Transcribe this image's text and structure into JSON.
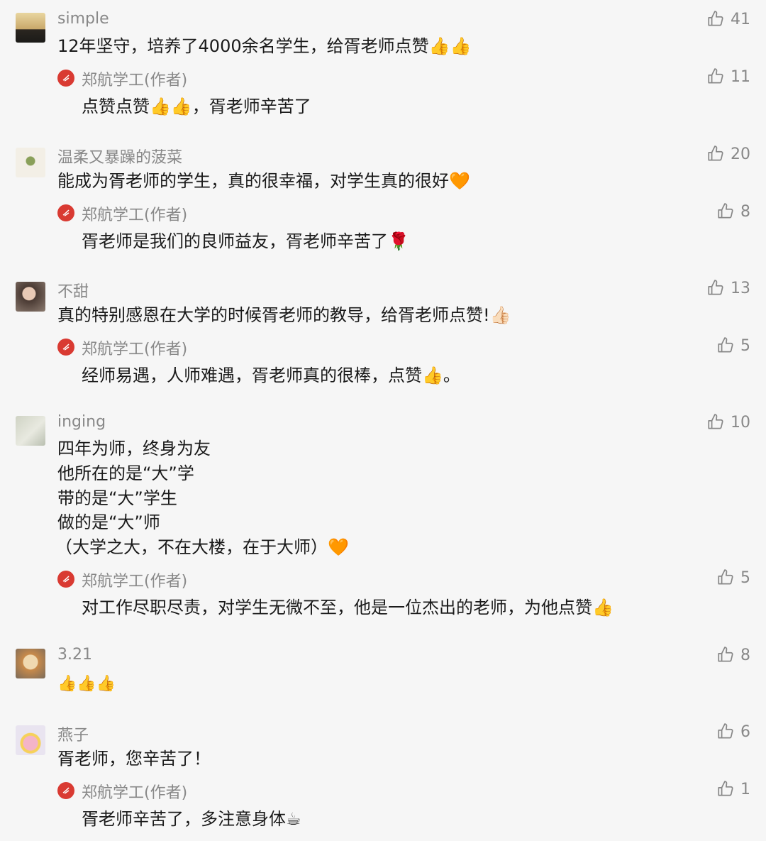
{
  "comments": [
    {
      "nickname": "simple",
      "lines": [
        "12年坚守，培养了4000余名学生，给胥老师点赞👍👍"
      ],
      "likes": "41",
      "reply": {
        "author": "郑航学工(作者)",
        "text": "点赞点赞👍👍，胥老师辛苦了",
        "likes": "11"
      }
    },
    {
      "nickname": "温柔又暴躁的菠菜",
      "lines": [
        "能成为胥老师的学生，真的很幸福，对学生真的很好🧡"
      ],
      "likes": "20",
      "reply": {
        "author": "郑航学工(作者)",
        "text": "胥老师是我们的良师益友，胥老师辛苦了🌹",
        "likes": "8"
      }
    },
    {
      "nickname": "不甜",
      "lines": [
        "真的特别感恩在大学的时候胥老师的教导，给胥老师点赞!👍🏻"
      ],
      "likes": "13",
      "reply": {
        "author": "郑航学工(作者)",
        "text": "经师易遇，人师难遇，胥老师真的很棒，点赞👍。",
        "likes": "5"
      }
    },
    {
      "nickname": "inging",
      "lines": [
        "四年为师，终身为友",
        "他所在的是“大”学",
        "带的是“大”学生",
        "做的是“大”师",
        "（大学之大，不在大楼，在于大师）🧡"
      ],
      "likes": "10",
      "reply": {
        "author": "郑航学工(作者)",
        "text": "对工作尽职尽责，对学生无微不至，他是一位杰出的老师，为他点赞👍",
        "likes": "5"
      }
    },
    {
      "nickname": "3.21",
      "lines": [
        "👍👍👍"
      ],
      "likes": "8"
    },
    {
      "nickname": "燕子",
      "lines": [
        "胥老师，您辛苦了！"
      ],
      "likes": "6",
      "reply": {
        "author": "郑航学工(作者)",
        "text": "胥老师辛苦了，多注意身体☕",
        "likes": "1"
      }
    }
  ]
}
